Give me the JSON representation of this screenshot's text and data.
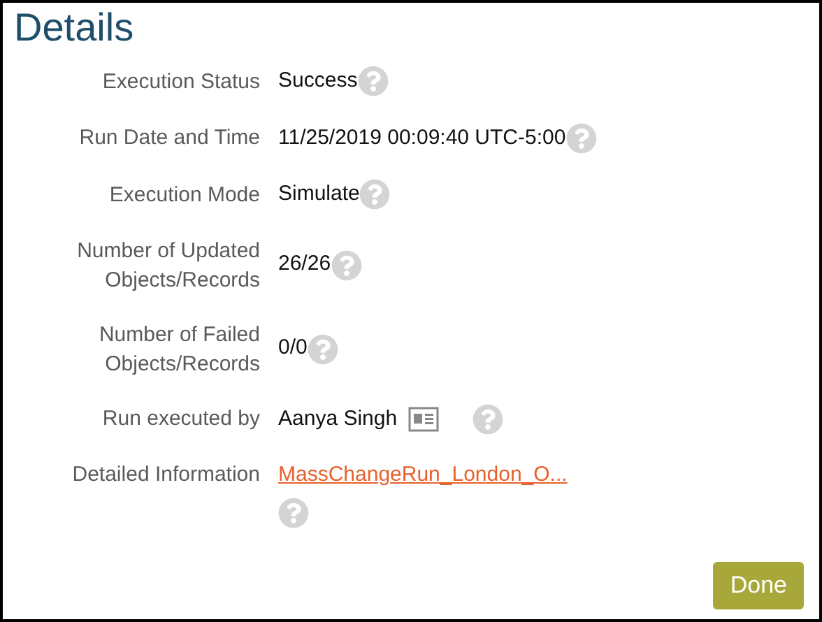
{
  "title": "Details",
  "fields": [
    {
      "kind": "text",
      "label": "Execution Status",
      "value": "Success"
    },
    {
      "kind": "text",
      "label": "Run Date and Time",
      "value": "11/25/2019 00:09:40 UTC-5:00"
    },
    {
      "kind": "text",
      "label": "Execution Mode",
      "value": "Simulate"
    },
    {
      "kind": "text",
      "label": "Number of Updated Objects/Records",
      "value": "26/26"
    },
    {
      "kind": "text",
      "label": "Number of Failed Objects/Records",
      "value": "0/0"
    },
    {
      "kind": "person",
      "label": "Run executed by",
      "value": "Aanya Singh"
    },
    {
      "kind": "link",
      "label": "Detailed Information",
      "value": "MassChangeRun_London_O..."
    }
  ],
  "button": "Done"
}
